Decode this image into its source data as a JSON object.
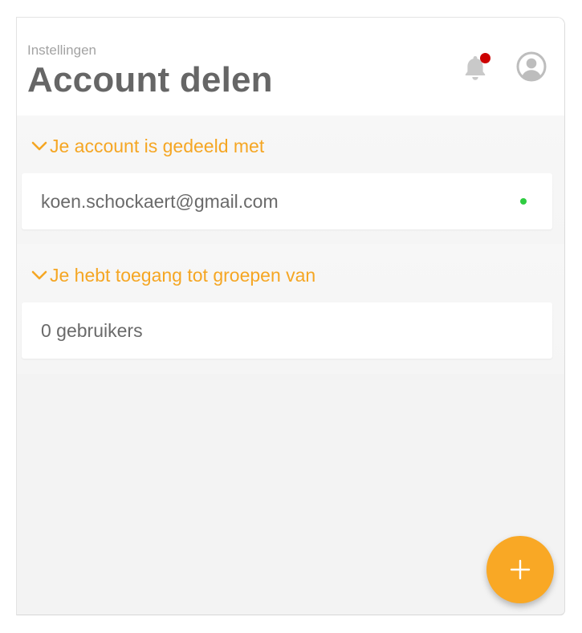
{
  "header": {
    "breadcrumb": "Instellingen",
    "title": "Account delen",
    "notification_badge_color": "#cc0000"
  },
  "sections": [
    {
      "title": "Je account is gedeeld met",
      "items": [
        {
          "text": "koen.schockaert@gmail.com",
          "status": "online",
          "status_color": "#2ecc40"
        }
      ]
    },
    {
      "title": "Je hebt toegang tot groepen van",
      "items": [
        {
          "text": "0 gebruikers"
        }
      ]
    }
  ],
  "fab": {
    "icon": "plus-icon"
  },
  "colors": {
    "accent": "#f5a623",
    "fab": "#f9a825",
    "title_text": "#666666"
  }
}
